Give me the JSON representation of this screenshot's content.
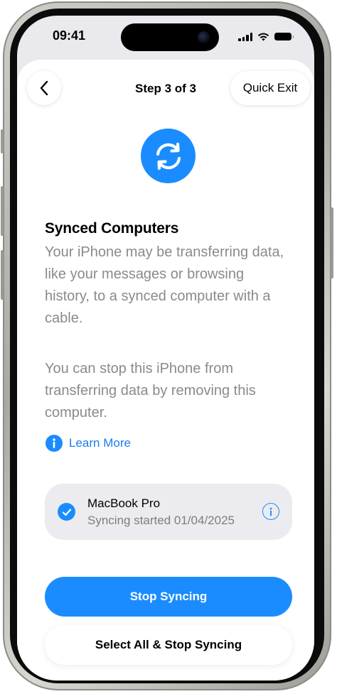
{
  "status_bar": {
    "time": "09:41",
    "icons": [
      "cellular-signal-icon",
      "wifi-icon",
      "battery-icon"
    ]
  },
  "nav": {
    "back_icon": "chevron-left-icon",
    "title": "Step 3 of 3",
    "quick_exit_label": "Quick Exit"
  },
  "hero_icon": "sync-arrows-icon",
  "content": {
    "heading": "Synced Computers",
    "paragraph_1": "Your iPhone may be transferring data, like your messages or browsing history, to a synced computer with a cable.",
    "paragraph_2": "You can stop this iPhone from transferring data by removing this computer.",
    "learn_more_label": "Learn More"
  },
  "device": {
    "name": "MacBook Pro",
    "status": "Syncing started 01/04/2025",
    "selected": true,
    "info_icon": "info-circle-icon"
  },
  "buttons": {
    "primary_label": "Stop Syncing",
    "secondary_label": "Select All & Stop Syncing"
  },
  "colors": {
    "accent": "#1a8cff",
    "link": "#1a7cf0",
    "secondary_text": "#8a8a8e",
    "card_background": "#ececf0"
  }
}
